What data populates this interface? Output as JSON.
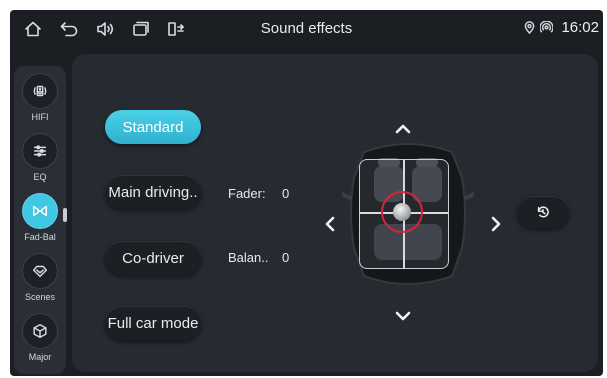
{
  "statusbar": {
    "title": "Sound effects",
    "time": "16:02",
    "left_icons": [
      "home-icon",
      "back-icon",
      "volume-icon",
      "recent-apps-icon",
      "car-mirror-icon"
    ],
    "right_icons": [
      "location-icon",
      "hotspot-icon"
    ]
  },
  "sidebar": {
    "items": [
      {
        "label": "HIFI",
        "icon": "hifi-speaker-icon",
        "active": false
      },
      {
        "label": "EQ",
        "icon": "eq-sliders-icon",
        "active": false
      },
      {
        "label": "Fad-Bal",
        "icon": "fader-balance-icon",
        "active": true
      },
      {
        "label": "Scenes",
        "icon": "scenes-icon",
        "active": false
      },
      {
        "label": "Major",
        "icon": "major-cube-icon",
        "active": false
      }
    ]
  },
  "modes": [
    {
      "label": "Standard",
      "active": true
    },
    {
      "label": "Main driving..",
      "active": false
    },
    {
      "label": "Co-driver",
      "active": false
    },
    {
      "label": "Full car mode",
      "active": false
    }
  ],
  "fader": {
    "label": "Fader:",
    "value": "0"
  },
  "balance": {
    "label": "Balan..",
    "value": "0"
  },
  "colors": {
    "accent": "#41c7e4",
    "knob_ring": "#d8243a",
    "background": "#1b1e23",
    "panel": "#262a31"
  }
}
